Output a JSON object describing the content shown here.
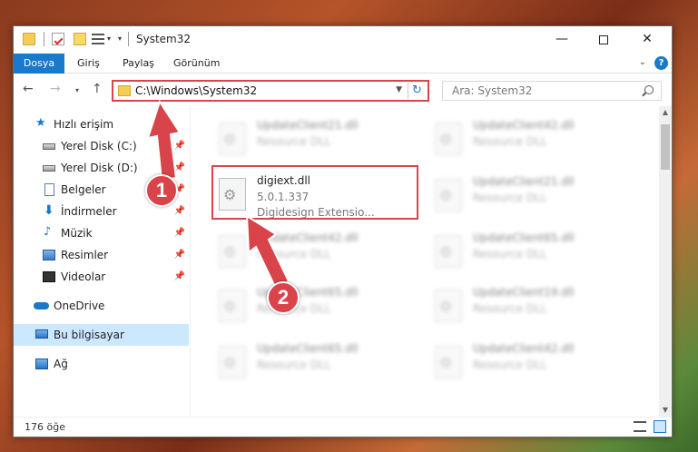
{
  "window": {
    "title": "System32",
    "minimize_icon": "minimize-icon",
    "maximize_icon": "maximize-icon",
    "close_icon": "close-icon"
  },
  "ribbon": {
    "tabs": [
      "Dosya",
      "Giriş",
      "Paylaş",
      "Görünüm"
    ]
  },
  "nav": {
    "address": "C:\\Windows\\System32",
    "search_placeholder": "Ara: System32"
  },
  "sidebar": {
    "items": [
      {
        "label": "Hızlı erişim",
        "icon": "star-icon",
        "pinned": false
      },
      {
        "label": "Yerel Disk (C:)",
        "icon": "drive-icon",
        "pinned": true
      },
      {
        "label": "Yerel Disk (D:)",
        "icon": "drive-icon",
        "pinned": true
      },
      {
        "label": "Belgeler",
        "icon": "document-icon",
        "pinned": true
      },
      {
        "label": "İndirmeler",
        "icon": "download-icon",
        "pinned": true
      },
      {
        "label": "Müzik",
        "icon": "music-icon",
        "pinned": true
      },
      {
        "label": "Resimler",
        "icon": "pictures-icon",
        "pinned": true
      },
      {
        "label": "Videolar",
        "icon": "video-icon",
        "pinned": true
      },
      {
        "label": "OneDrive",
        "icon": "cloud-icon",
        "pinned": false
      },
      {
        "label": "Bu bilgisayar",
        "icon": "computer-icon",
        "pinned": false,
        "selected": true
      },
      {
        "label": "Ağ",
        "icon": "network-icon",
        "pinned": false
      }
    ]
  },
  "files": {
    "col1": [
      {
        "name": "UpdateClient21.dll",
        "type": "Resource DLL"
      },
      {
        "name": "digiext.dll",
        "version": "5.0.1.337",
        "description": "Digidesign Extensio..."
      },
      {
        "name": "UpdateClient42.dll",
        "type": "Resource DLL"
      },
      {
        "name": "UpdateClient65.dll",
        "type": "Resource DLL"
      },
      {
        "name": "UpdateClient65.dll",
        "type": "Resource DLL"
      }
    ],
    "col2": [
      {
        "name": "UpdateClient42.dll",
        "type": "Resource DLL"
      },
      {
        "name": "UpdateClient21.dll",
        "type": "Resource DLL"
      },
      {
        "name": "UpdateClient65.dll",
        "type": "Resource DLL"
      },
      {
        "name": "UpdateClient19.dll",
        "type": "Resource DLL"
      },
      {
        "name": "UpdateClient42.dll",
        "type": "Resource DLL"
      }
    ]
  },
  "status": {
    "count": "176 öğe"
  },
  "annotations": {
    "step1": "1",
    "step2": "2",
    "color": "#d9444a"
  }
}
